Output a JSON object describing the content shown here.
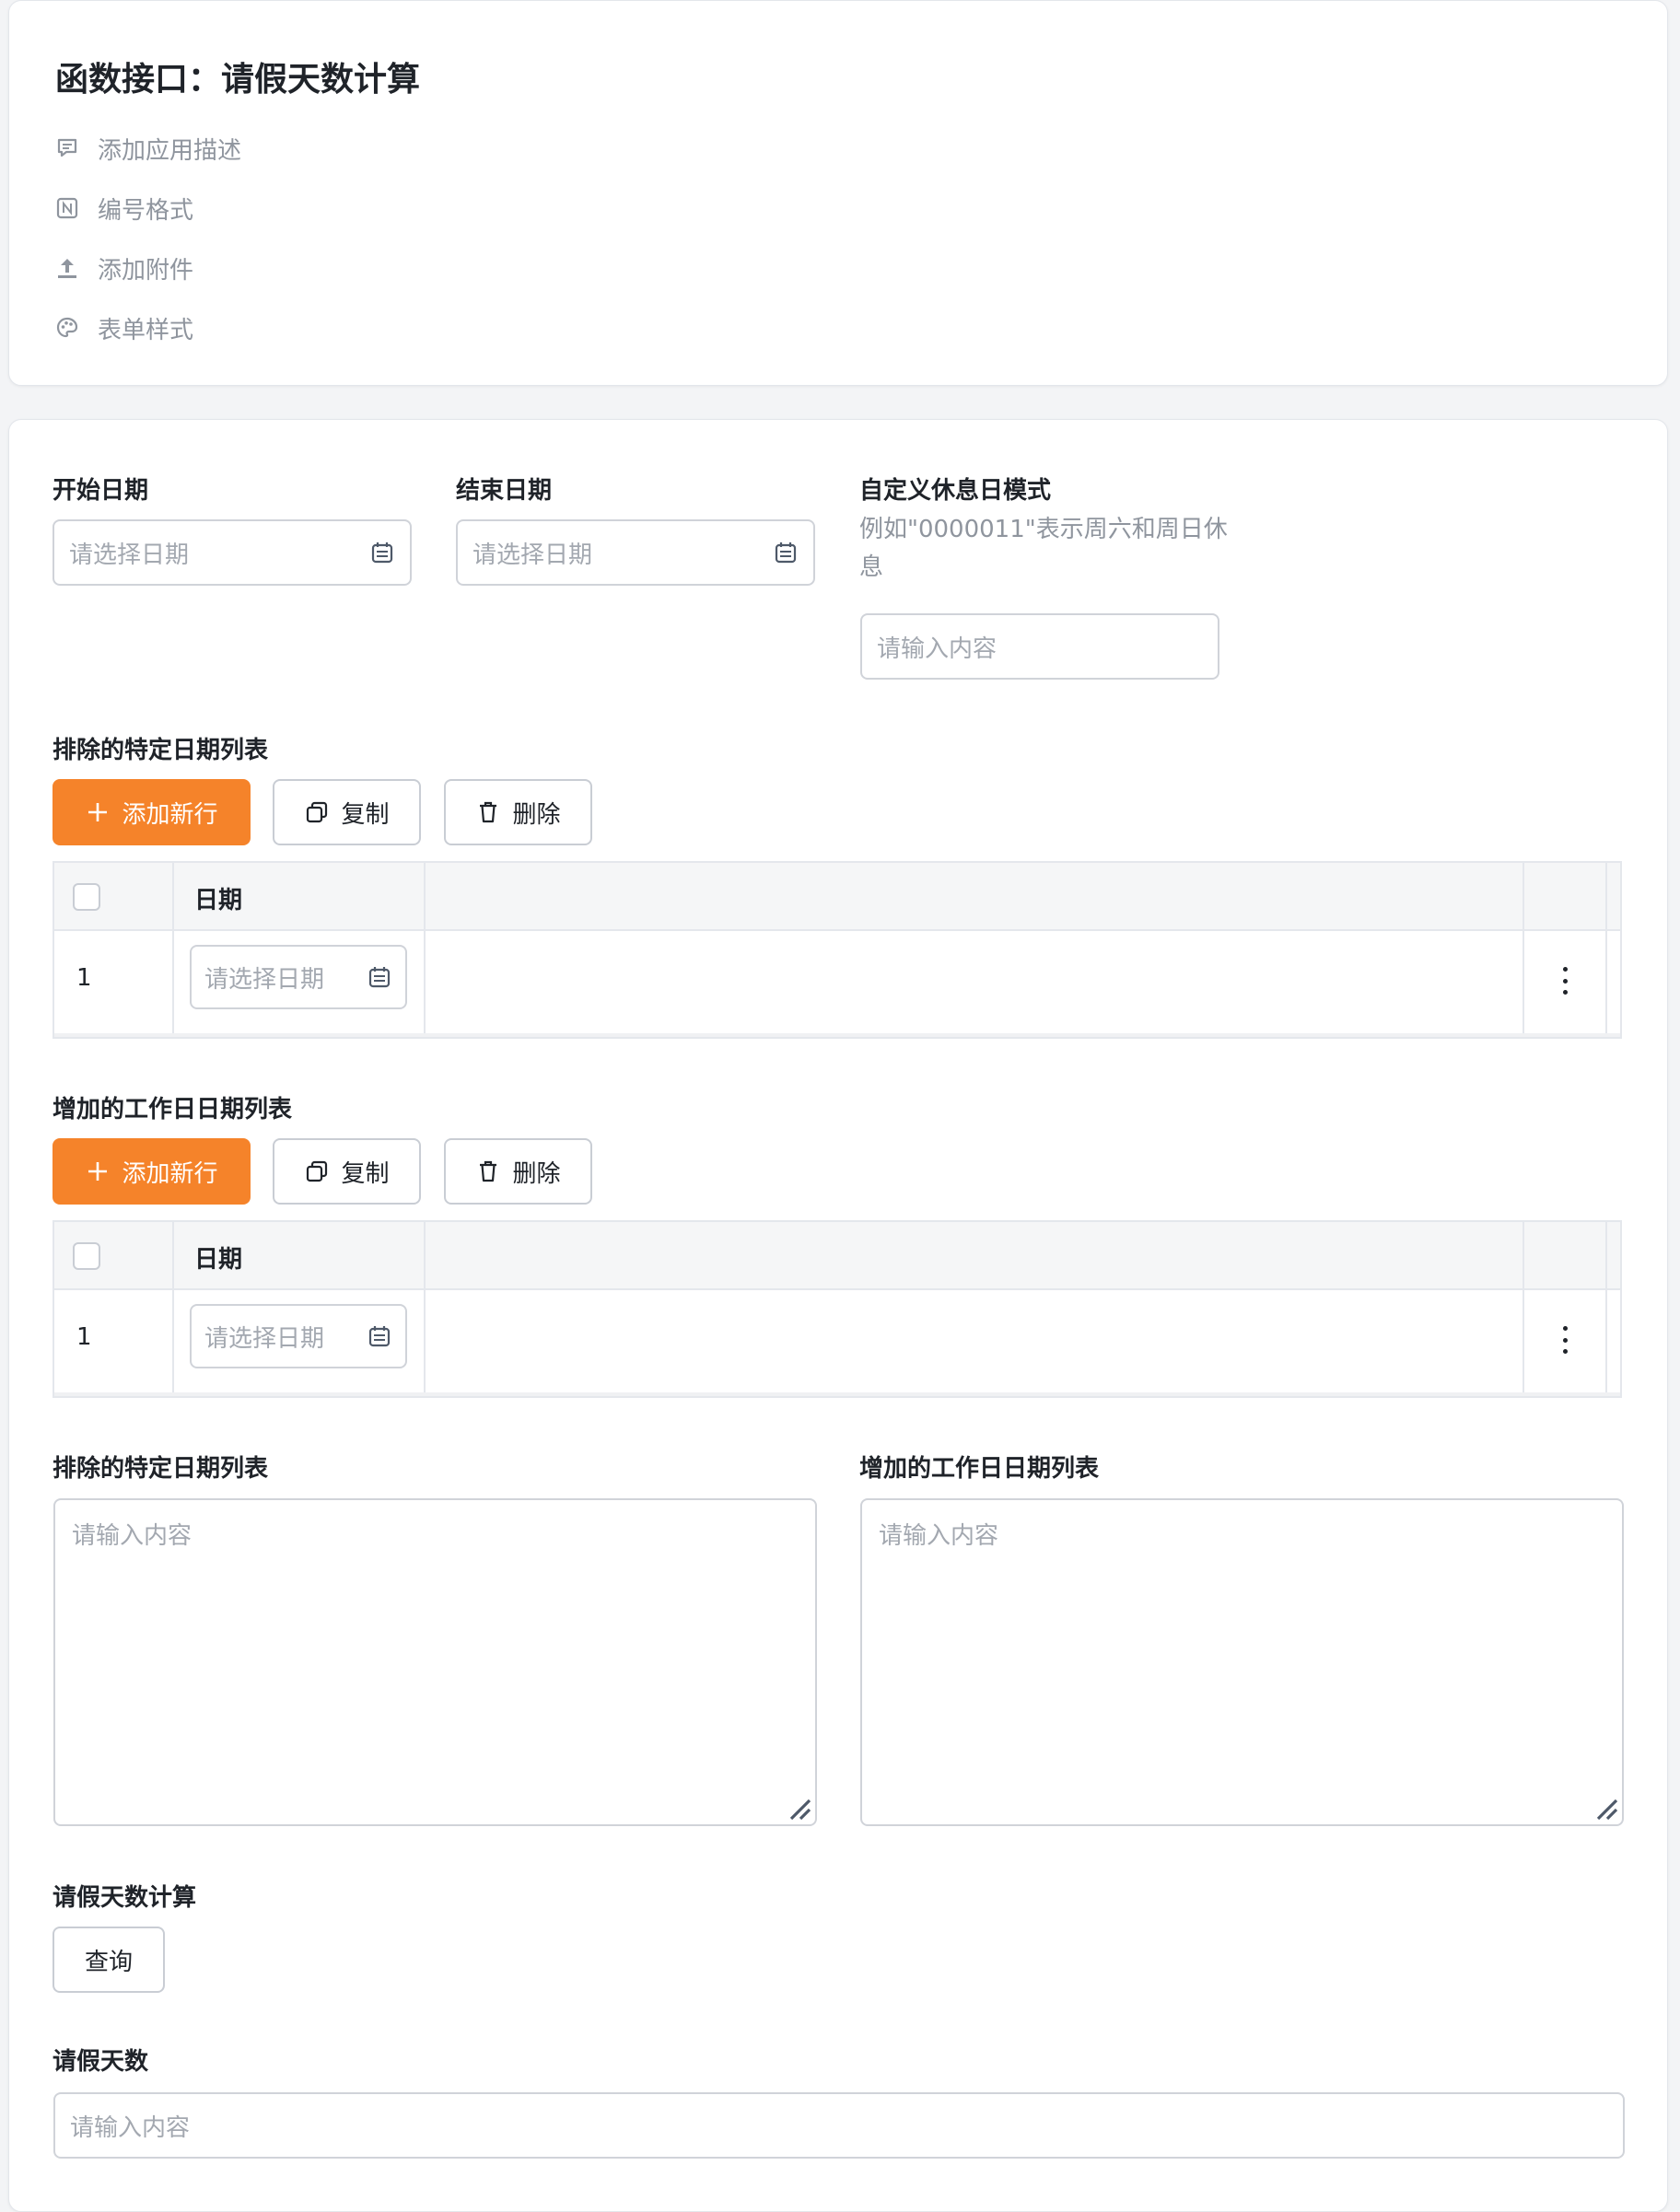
{
  "header": {
    "title": "函数接口：请假天数计算",
    "meta": [
      {
        "label": "添加应用描述",
        "icon": "comment-icon"
      },
      {
        "label": "编号格式",
        "icon": "numbering-icon"
      },
      {
        "label": "添加附件",
        "icon": "upload-icon"
      },
      {
        "label": "表单样式",
        "icon": "palette-icon"
      }
    ]
  },
  "form": {
    "start_date": {
      "label": "开始日期",
      "placeholder": "请选择日期"
    },
    "end_date": {
      "label": "结束日期",
      "placeholder": "请选择日期"
    },
    "rest_pattern": {
      "label": "自定义休息日模式",
      "hint": "例如\"0000011\"表示周六和周日休息",
      "placeholder": "请输入内容"
    },
    "exclude_table": {
      "label": "排除的特定日期列表",
      "buttons": {
        "add": "添加新行",
        "copy": "复制",
        "delete": "删除"
      },
      "column": "日期",
      "rows": [
        {
          "index": "1",
          "placeholder": "请选择日期"
        }
      ]
    },
    "workday_table": {
      "label": "增加的工作日日期列表",
      "buttons": {
        "add": "添加新行",
        "copy": "复制",
        "delete": "删除"
      },
      "column": "日期",
      "rows": [
        {
          "index": "1",
          "placeholder": "请选择日期"
        }
      ]
    },
    "exclude_text": {
      "label": "排除的特定日期列表",
      "placeholder": "请输入内容"
    },
    "workday_text": {
      "label": "增加的工作日日期列表",
      "placeholder": "请输入内容"
    },
    "calc": {
      "label": "请假天数计算",
      "button": "查询"
    },
    "days": {
      "label": "请假天数",
      "placeholder": "请输入内容"
    }
  },
  "colors": {
    "primary": "#f5832a",
    "border": "#d0d3d9",
    "muted": "#8f959e"
  }
}
